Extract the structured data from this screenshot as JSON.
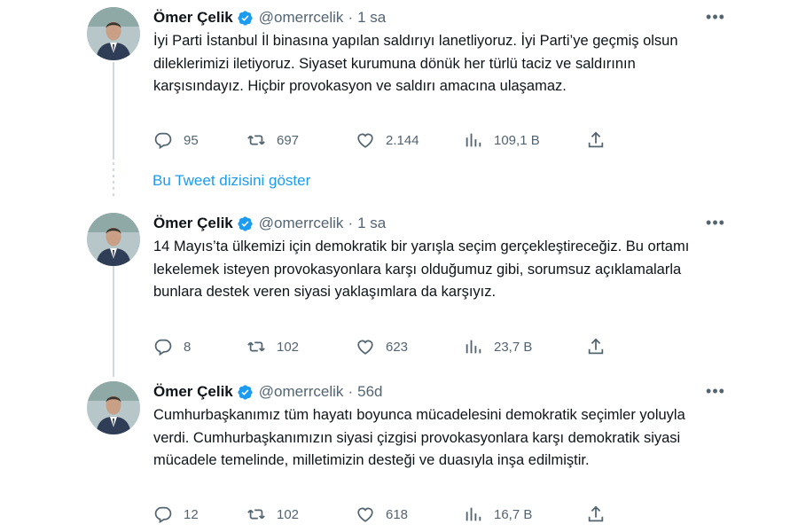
{
  "colors": {
    "accent": "#1d9bf0",
    "muted": "#536471",
    "text": "#0f1419",
    "thread_line": "#cfd9de"
  },
  "show_thread_label": "Bu Tweet dizisini göster",
  "tweets": [
    {
      "author": "Ömer Çelik",
      "handle": "@omerrcelik",
      "separator": "·",
      "time": "1 sa",
      "text": "İyi Parti İstanbul İl binasına yapılan saldırıyı lanetliyoruz. İyi Parti’ye geçmiş olsun dileklerimizi iletiyoruz. Siyaset kurumuna dönük her türlü taciz ve saldırının karşısındayız. Hiçbir provokasyon ve saldırı amacına ulaşamaz.",
      "replies": "95",
      "retweets": "697",
      "likes": "2.144",
      "views": "109,1 B"
    },
    {
      "author": "Ömer Çelik",
      "handle": "@omerrcelik",
      "separator": "·",
      "time": "1 sa",
      "text": "14 Mayıs’ta ülkemizi için demokratik bir yarışla seçim gerçekleştireceğiz. Bu ortamı lekelemek isteyen provokasyonlara karşı olduğumuz gibi, sorumsuz açıklamalarla bunlara destek veren siyasi yaklaşımlara da karşıyız.",
      "replies": "8",
      "retweets": "102",
      "likes": "623",
      "views": "23,7 B"
    },
    {
      "author": "Ömer Çelik",
      "handle": "@omerrcelik",
      "separator": "·",
      "time": "56d",
      "text": "Cumhurbaşkanımız tüm hayatı boyunca mücadelesini demokratik seçimler yoluyla verdi. Cumhurbaşkanımızın siyasi çizgisi provokasyonlara karşı demokratik siyasi mücadele temelinde, milletimizin desteği ve duasıyla inşa edilmiştir.",
      "replies": "12",
      "retweets": "102",
      "likes": "618",
      "views": "16,7 B"
    }
  ],
  "icons": {
    "verified": "verified-badge-icon",
    "more": "more-options-icon",
    "reply": "reply-icon",
    "retweet": "retweet-icon",
    "like": "like-icon",
    "views": "views-icon",
    "share": "share-icon"
  }
}
